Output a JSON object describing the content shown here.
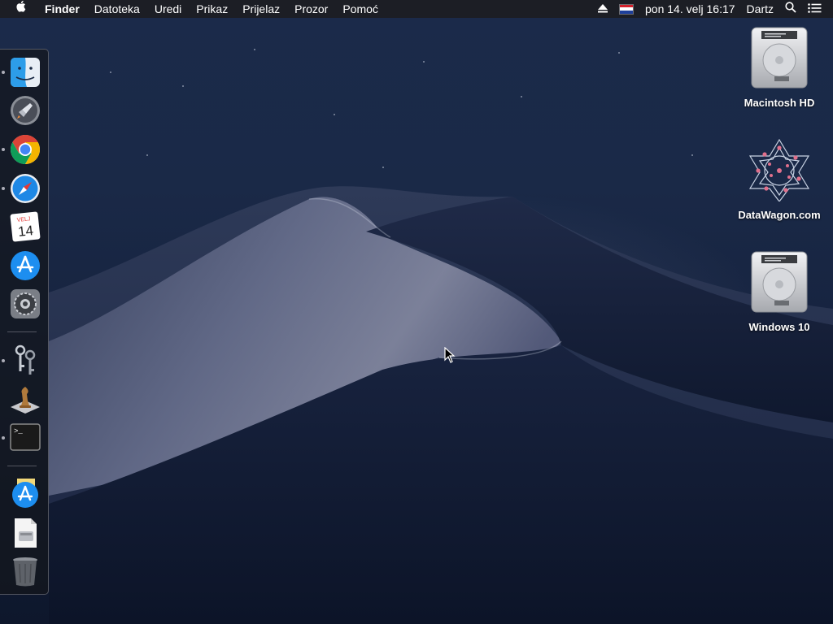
{
  "menubar": {
    "apple_icon": "apple-icon",
    "app_name": "Finder",
    "menus": [
      "Datoteka",
      "Uredi",
      "Prikaz",
      "Prijelaz",
      "Prozor",
      "Pomoć"
    ],
    "status": {
      "eject_icon": "eject-icon",
      "input_source_icon": "croatian-flag-icon",
      "datetime": "pon 14. velj  16:17",
      "user": "Dartz",
      "spotlight_icon": "search-icon",
      "notification_icon": "list-icon"
    }
  },
  "dock": {
    "items": [
      {
        "name": "Finder",
        "icon": "finder-icon",
        "running": true
      },
      {
        "name": "Launchpad",
        "icon": "launchpad-icon",
        "running": false
      },
      {
        "name": "Google Chrome",
        "icon": "chrome-icon",
        "running": true
      },
      {
        "name": "Safari",
        "icon": "safari-icon",
        "running": true
      },
      {
        "name": "Calendar",
        "icon": "calendar-icon",
        "running": false,
        "month": "VELJ",
        "day": "14"
      },
      {
        "name": "App Store",
        "icon": "app-store-icon",
        "running": false
      },
      {
        "name": "System Preferences",
        "icon": "system-preferences-icon",
        "running": false
      },
      {
        "name": "Keychain Access",
        "icon": "keychain-icon",
        "running": true
      },
      {
        "name": "Chess",
        "icon": "chess-icon",
        "running": false
      },
      {
        "name": "Terminal",
        "icon": "terminal-icon",
        "running": true,
        "prompt": ">_"
      },
      {
        "name": "Applications",
        "icon": "app-store-folder-icon",
        "running": false
      },
      {
        "name": "Disk Image",
        "icon": "document-icon",
        "running": false
      },
      {
        "name": "Trash",
        "icon": "trash-icon",
        "running": false
      }
    ]
  },
  "desktop": {
    "icons": [
      {
        "label": "Macintosh HD",
        "icon": "hard-drive-icon"
      },
      {
        "label": "DataWagon.com",
        "icon": "datawagon-logo-icon"
      },
      {
        "label": "Windows 10",
        "icon": "hard-drive-icon"
      }
    ]
  },
  "colors": {
    "menubar_bg": "#1c1c20",
    "sky_top": "#1b2a4a",
    "sky_bottom": "#0e172c",
    "dock_bg": "#14161c"
  }
}
